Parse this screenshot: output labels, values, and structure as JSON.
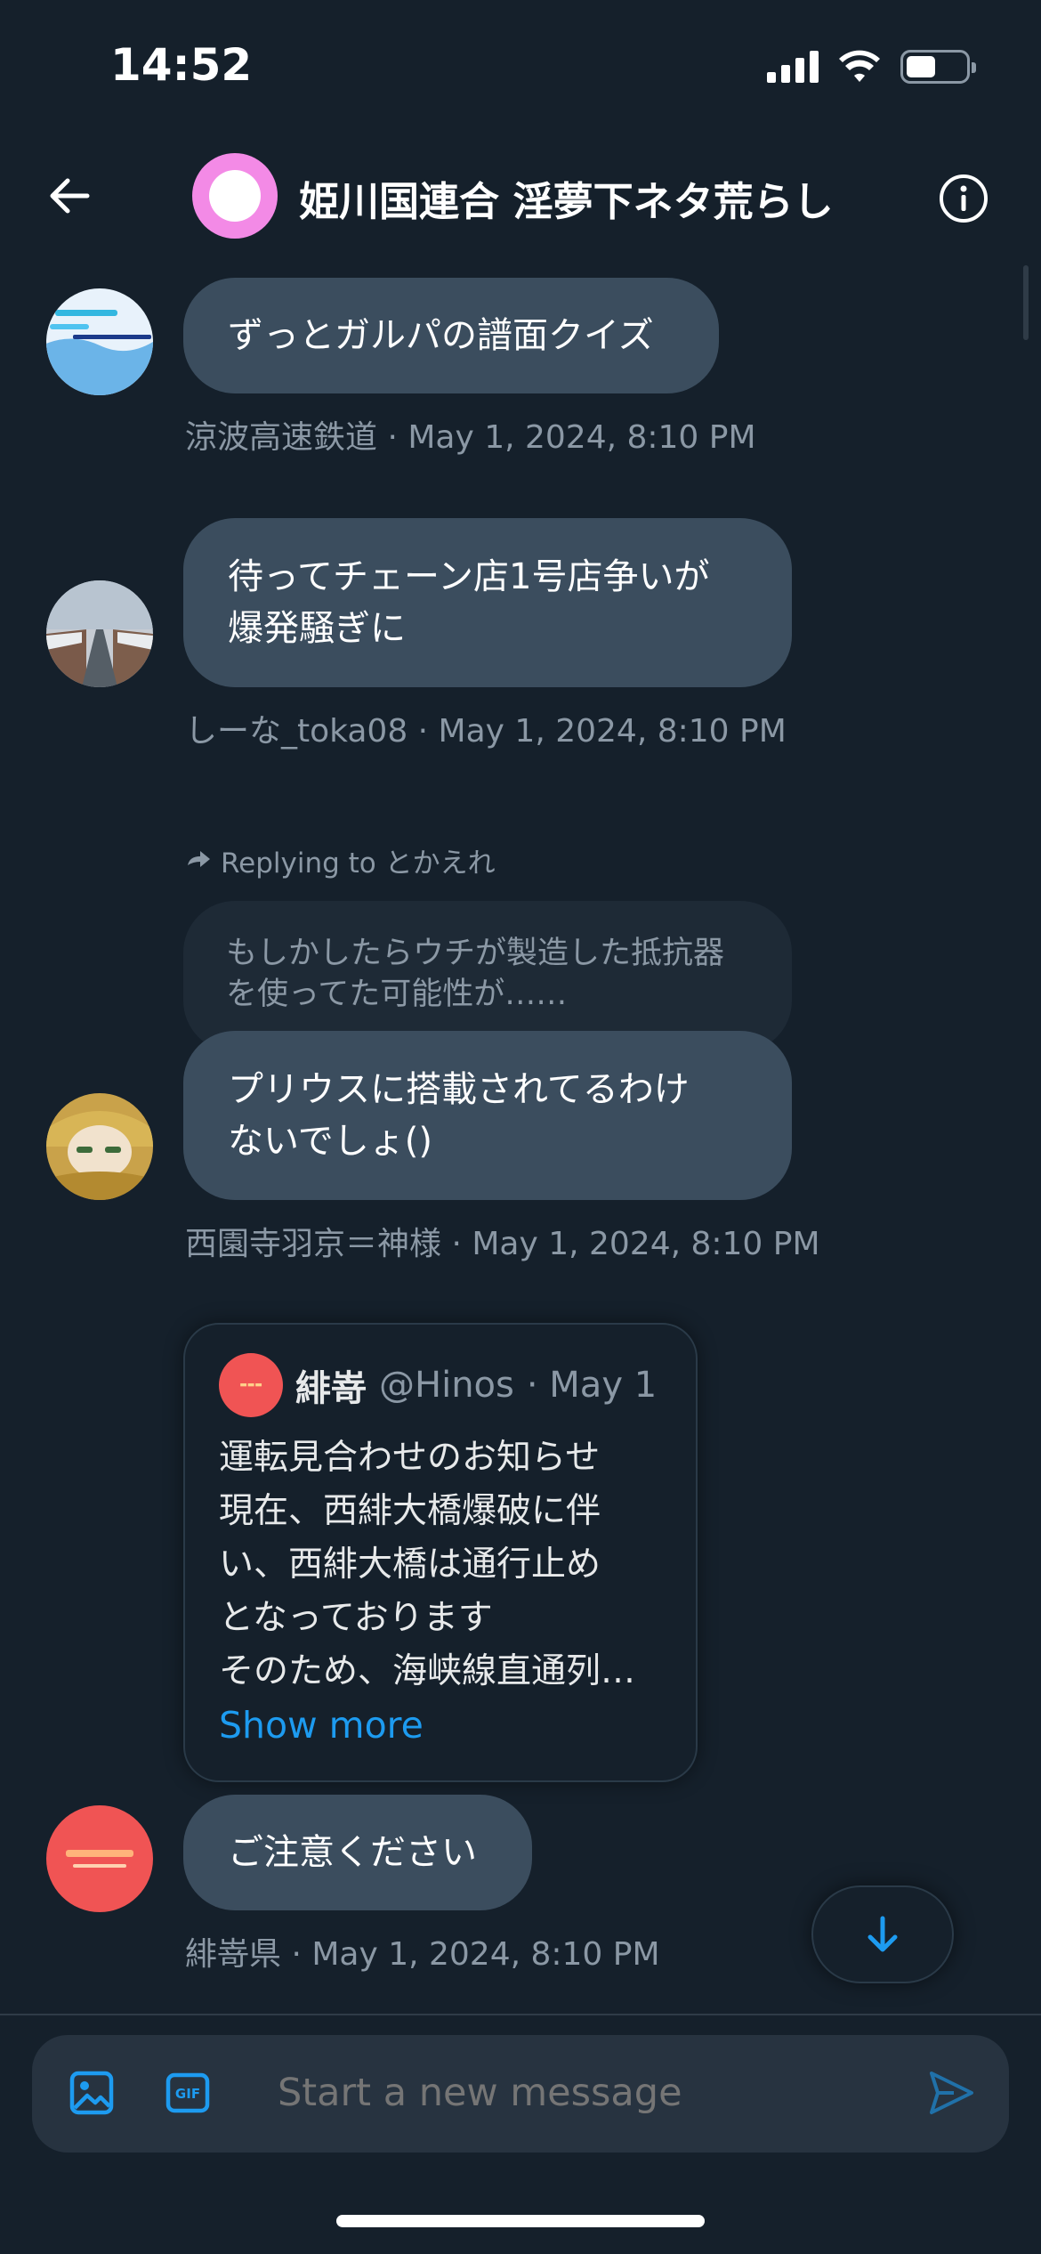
{
  "status_bar": {
    "time": "14:52"
  },
  "header": {
    "title": "姫川国連合 淫夢下ネタ荒らし"
  },
  "messages": [
    {
      "text": "ずっとガルパの譜面クイズ",
      "meta": "涼波高速鉄道 · May 1, 2024, 8:10 PM"
    },
    {
      "lines": [
        "待ってチェーン店1号店争いが",
        "爆発騒ぎに"
      ],
      "meta": "しーな_toka08 · May 1, 2024, 8:10 PM"
    },
    {
      "reply_label": "Replying to とかえれ",
      "reply_preview": [
        "もしかしたらウチが製造した抵抗器",
        "を使ってた可能性が……"
      ],
      "lines": [
        "プリウスに搭載されてるわけ",
        "ないでしょ()"
      ],
      "meta": "西園寺羽京＝神様 · May 1, 2024, 8:10 PM"
    },
    {
      "quote": {
        "name": "緋嵜",
        "handle": "@Hinos",
        "date": "· May 1",
        "lines": [
          "運転見合わせのお知らせ",
          "現在、西緋大橋爆破に伴",
          "い、西緋大橋は通行止め",
          "となっております",
          "そのため、海峡線直通列…"
        ],
        "show_more": "Show more"
      },
      "text": "ご注意ください",
      "meta": "緋嵜県 · May 1, 2024, 8:10 PM"
    }
  ],
  "composer": {
    "placeholder": "Start a new message",
    "gif_label": "GIF"
  },
  "colors": {
    "background": "#15202b",
    "bubble": "#3b4d5e",
    "accent": "#1d9bf0",
    "muted": "#8b98a5"
  }
}
